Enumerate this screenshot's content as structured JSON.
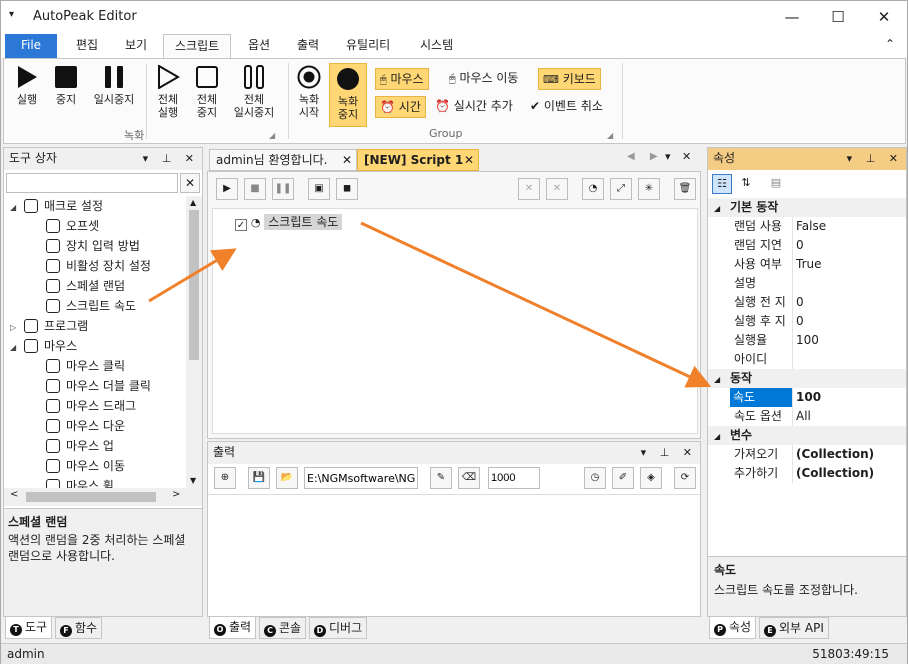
{
  "window": {
    "title": "AutoPeak Editor",
    "minimize": "—",
    "maximize": "☐",
    "close": "✕"
  },
  "menu": {
    "file": "File",
    "items": [
      "편집",
      "보기",
      "스크립트",
      "옵션",
      "출력",
      "유틸리티",
      "시스템"
    ],
    "collapse": "⌃"
  },
  "ribbon": {
    "run": "실행",
    "stop": "중지",
    "pause": "일시중지",
    "run_all_1": "전체",
    "run_all_2": "실행",
    "stop_all_1": "전체",
    "stop_all_2": "중지",
    "pause_all_1": "전체",
    "pause_all_2": "일시중지",
    "group1": "녹화",
    "rec_start_1": "녹화",
    "rec_start_2": "시작",
    "rec_stop_1": "녹화",
    "rec_stop_2": "중지",
    "mouse": "마우스",
    "mouse_move": "마우스 이동",
    "keyboard": "키보드",
    "time": "시간",
    "realtime_add": "실시간 추가",
    "event_cancel": "이벤트 취소",
    "group2": "Group"
  },
  "toolbox": {
    "title": "도구 상자",
    "search_value": "",
    "items": [
      {
        "label": "매크로 설정",
        "level": 0,
        "expander": "◢"
      },
      {
        "label": "오프셋",
        "level": 1,
        "expander": ""
      },
      {
        "label": "장치 입력 방법",
        "level": 1,
        "expander": ""
      },
      {
        "label": "비활성 장치 설정",
        "level": 1,
        "expander": ""
      },
      {
        "label": "스페셜 랜덤",
        "level": 1,
        "expander": ""
      },
      {
        "label": "스크립트 속도",
        "level": 1,
        "expander": ""
      },
      {
        "label": "프로그램",
        "level": 0,
        "expander": "▷"
      },
      {
        "label": "마우스",
        "level": 0,
        "expander": "◢"
      },
      {
        "label": "마우스 클릭",
        "level": 1,
        "expander": ""
      },
      {
        "label": "마우스 더블 클릭",
        "level": 1,
        "expander": ""
      },
      {
        "label": "마우스 드래그",
        "level": 1,
        "expander": ""
      },
      {
        "label": "마우스 다운",
        "level": 1,
        "expander": ""
      },
      {
        "label": "마우스 업",
        "level": 1,
        "expander": ""
      },
      {
        "label": "마우스 이동",
        "level": 1,
        "expander": ""
      },
      {
        "label": "마우스 휠",
        "level": 1,
        "expander": ""
      }
    ],
    "desc_title": "스페셜 랜덤",
    "desc_text": "액션의 랜덤을 2중 처리하는 스페셜 랜덤으로 사용합니다.",
    "tabs": [
      {
        "letter": "T",
        "label": "도구"
      },
      {
        "letter": "F",
        "label": "함수"
      }
    ]
  },
  "editor": {
    "tabs": [
      "admin님 환영합니다.",
      "[NEW] Script 1"
    ],
    "script_node": "스크립트 속도"
  },
  "output": {
    "title": "출력",
    "path": "E:\\NGMsoftware\\NG",
    "number": "1000",
    "tabs": [
      {
        "letter": "O",
        "label": "출력"
      },
      {
        "letter": "C",
        "label": "콘솔"
      },
      {
        "letter": "D",
        "label": "디버그"
      }
    ]
  },
  "properties": {
    "title": "속성",
    "categories": [
      {
        "name": "기본 동작",
        "rows": [
          {
            "name": "랜덤 사용",
            "value": "False",
            "bold": false
          },
          {
            "name": "랜덤 지연",
            "value": "0",
            "bold": false
          },
          {
            "name": "사용 여부",
            "value": "True",
            "bold": false
          },
          {
            "name": "설명",
            "value": "",
            "bold": false
          },
          {
            "name": "실행 전 지",
            "value": "0",
            "bold": false
          },
          {
            "name": "실행 후 지",
            "value": "0",
            "bold": false
          },
          {
            "name": "실행율",
            "value": "100",
            "bold": false
          },
          {
            "name": "아이디",
            "value": "",
            "bold": false
          }
        ]
      },
      {
        "name": "동작",
        "rows": [
          {
            "name": "속도",
            "value": "100",
            "bold": true,
            "selected": true
          },
          {
            "name": "속도 옵션",
            "value": "All",
            "bold": false
          }
        ]
      },
      {
        "name": "변수",
        "rows": [
          {
            "name": "가져오기",
            "value": "(Collection)",
            "bold": true
          },
          {
            "name": "추가하기",
            "value": "(Collection)",
            "bold": true
          }
        ]
      }
    ],
    "desc_title": "속도",
    "desc_text": "스크립트 속도를 조정합니다.",
    "tabs": [
      {
        "letter": "P",
        "label": "속성"
      },
      {
        "letter": "E",
        "label": "외부 API"
      }
    ]
  },
  "status": {
    "user": "admin",
    "time": "51803:49:15"
  },
  "colors": {
    "accent": "#2b78d6",
    "highlight": "#ffd774",
    "arrow": "#f0802a",
    "selection": "#0078d7"
  }
}
